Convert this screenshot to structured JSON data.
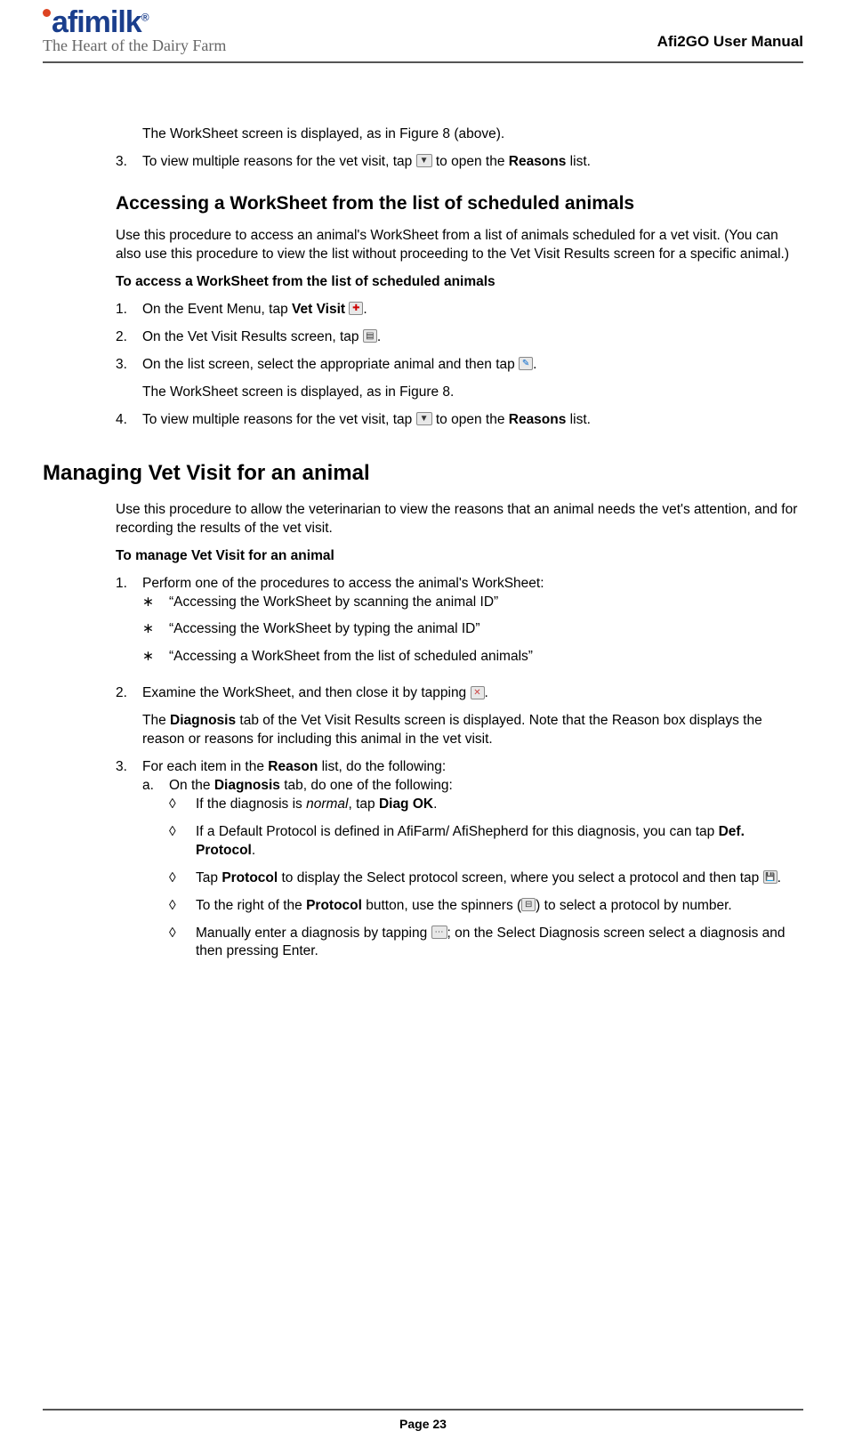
{
  "header": {
    "logo_name": "afimilk",
    "logo_tagline": "The Heart of the Dairy Farm",
    "doc_title": "Afi2GO User Manual"
  },
  "intro": {
    "worksheet_displayed": "The WorkSheet screen is displayed, as in Figure 8 (above).",
    "step3_num": "3.",
    "step3_a": "To view multiple reasons for the vet visit, tap ",
    "step3_b": " to open the ",
    "step3_bold": "Reasons",
    "step3_c": " list."
  },
  "section1": {
    "heading": "Accessing a WorkSheet from the list of scheduled animals",
    "para": "Use this procedure to access an animal's WorkSheet from a list of animals scheduled for a vet visit.  (You can also use this procedure to view the list without proceeding to the Vet Visit Results screen for a specific animal.)",
    "proc_head": "To access a WorkSheet from the list of scheduled animals",
    "s1_num": "1.",
    "s1_a": "On the Event Menu, tap ",
    "s1_bold": "Vet Visit",
    "s1_b": " ",
    "s1_c": ".",
    "s2_num": "2.",
    "s2_a": "On the Vet Visit Results screen, tap ",
    "s2_b": ".",
    "s3_num": "3.",
    "s3_a": "On the list screen, select the appropriate animal and then tap ",
    "s3_b": ".",
    "s3_sub": "The WorkSheet screen is displayed, as in Figure 8.",
    "s4_num": "4.",
    "s4_a": "To view multiple reasons for the vet visit, tap ",
    "s4_b": " to open the ",
    "s4_bold": "Reasons",
    "s4_c": " list."
  },
  "section2": {
    "heading": "Managing Vet Visit for an animal",
    "para": "Use this procedure to allow the veterinarian to view the reasons that an animal needs the vet's attention, and for recording the results of the vet visit.",
    "proc_head": "To manage Vet Visit for an animal",
    "s1_num": "1.",
    "s1_text": "Perform one of the procedures to access the animal's WorkSheet:",
    "star_a": "“Accessing the WorkSheet by scanning the animal ID”",
    "star_b": "“Accessing the WorkSheet by typing the animal ID”",
    "star_c": "“Accessing a WorkSheet from the list of scheduled animals”",
    "s2_num": "2.",
    "s2_a": "Examine the WorkSheet, and then close it by tapping ",
    "s2_b": ".",
    "s2_sub_a": "The ",
    "s2_sub_bold": "Diagnosis",
    "s2_sub_b": " tab of the Vet Visit Results screen is displayed.  Note that the Reason box displays the reason or reasons for including this animal in the vet visit.",
    "s3_num": "3.",
    "s3_a": "For each item in the ",
    "s3_bold": "Reason",
    "s3_b": " list, do the following:",
    "a_num": "a.",
    "a_a": "On the ",
    "a_bold": "Diagnosis",
    "a_b": " tab, do one of the following:",
    "d1_a": "If the diagnosis is ",
    "d1_ital": "normal",
    "d1_b": ", tap ",
    "d1_bold": "Diag OK",
    "d1_c": ".",
    "d2_a": "If a Default Protocol is defined in AfiFarm/ AfiShepherd for this diagnosis, you can tap ",
    "d2_bold": "Def. Protocol",
    "d2_b": ".",
    "d3_a": "Tap ",
    "d3_bold": "Protocol",
    "d3_b": " to display the Select protocol screen, where you select a protocol and then tap ",
    "d3_c": ".",
    "d4_a": "To the right of the ",
    "d4_bold": "Protocol",
    "d4_b": " button, use the spinners (",
    "d4_c": ") to select a protocol by number.",
    "d5_a": "Manually enter a diagnosis by tapping ",
    "d5_b": "; on the Select Diagnosis screen select a diagnosis and then pressing Enter."
  },
  "footer": {
    "page": "Page 23"
  },
  "icons": {
    "dropdown": "▼",
    "plus": "✚",
    "list": "▤",
    "edit": "✎",
    "close": "✕",
    "save": "💾",
    "spinner": "⊟",
    "ellipsis": "⋯"
  }
}
